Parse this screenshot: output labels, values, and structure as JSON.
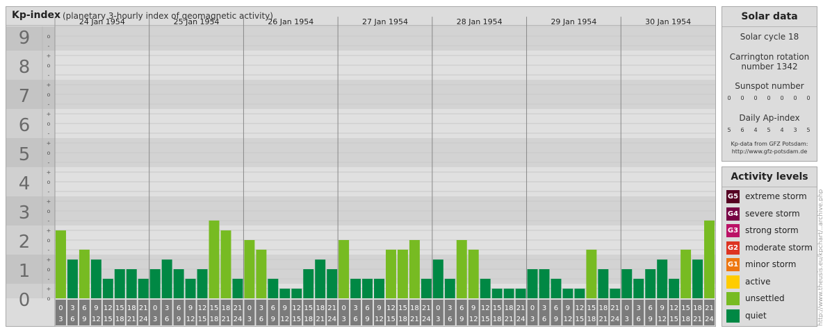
{
  "header": {
    "title": "Kp-index",
    "subtitle": "(planetary 3-hourly index of geomagnetic activity)"
  },
  "chart_data": {
    "type": "bar",
    "title": "Kp-index",
    "subtitle": "(planetary 3-hourly index of geomagnetic activity)",
    "days": [
      "24 Jan 1954",
      "25 Jan 1954",
      "26 Jan 1954",
      "27 Jan 1954",
      "28 Jan 1954",
      "29 Jan 1954",
      "30 Jan 1954"
    ],
    "interval_labels": [
      [
        "0",
        "3"
      ],
      [
        "3",
        "6"
      ],
      [
        "6",
        "9"
      ],
      [
        "9",
        "12"
      ],
      [
        "12",
        "15"
      ],
      [
        "15",
        "18"
      ],
      [
        "18",
        "21"
      ],
      [
        "21",
        "24"
      ]
    ],
    "y_axis_labels": [
      "0",
      "1",
      "2",
      "3",
      "4",
      "5",
      "6",
      "7",
      "8",
      "9"
    ],
    "sub_tick_labels": [
      "+",
      "o",
      "-"
    ],
    "ylim": [
      0,
      9.33
    ],
    "values": [
      [
        2.33,
        1.33,
        1.67,
        1.33,
        0.67,
        1.0,
        1.0,
        0.67
      ],
      [
        1.0,
        1.33,
        1.0,
        0.67,
        1.0,
        2.67,
        2.33,
        0.67
      ],
      [
        2.0,
        1.67,
        0.67,
        0.33,
        0.33,
        1.0,
        1.33,
        1.0
      ],
      [
        2.0,
        0.67,
        0.67,
        0.67,
        1.67,
        1.67,
        2.0,
        0.67
      ],
      [
        1.33,
        0.67,
        2.0,
        1.67,
        0.67,
        0.33,
        0.33,
        0.33
      ],
      [
        1.0,
        1.0,
        0.67,
        0.33,
        0.33,
        1.67,
        1.0,
        0.33
      ],
      [
        1.0,
        0.67,
        1.0,
        1.33,
        0.67,
        1.67,
        1.33,
        2.67
      ]
    ],
    "series_colors": {
      "quiet": "#008844",
      "unsettled": "#77bb22"
    },
    "grid": true
  },
  "solar": {
    "title": "Solar data",
    "cycle": "Solar cycle 18",
    "carrington_line1": "Carrington rotation",
    "carrington_line2": "number 1342",
    "sunspot_label": "Sunspot number",
    "sunspot_values": [
      "0",
      "0",
      "0",
      "0",
      "0",
      "0",
      "0"
    ],
    "ap_label": "Daily Ap-index",
    "ap_values": [
      "5",
      "6",
      "4",
      "5",
      "4",
      "3",
      "5"
    ],
    "credit_line1": "Kp-data from GFZ Potsdam:",
    "credit_line2": "http://www.gfz-potsdam.de"
  },
  "activity": {
    "title": "Activity levels",
    "levels": [
      {
        "code": "G5",
        "label": "extreme storm",
        "color": "#550022"
      },
      {
        "code": "G4",
        "label": "severe storm",
        "color": "#770044"
      },
      {
        "code": "G3",
        "label": "strong storm",
        "color": "#bb1166"
      },
      {
        "code": "G2",
        "label": "moderate storm",
        "color": "#dd3322"
      },
      {
        "code": "G1",
        "label": "minor storm",
        "color": "#ee7711"
      },
      {
        "code": "",
        "label": "active",
        "color": "#ffcc00"
      },
      {
        "code": "",
        "label": "unsettled",
        "color": "#77bb22"
      },
      {
        "code": "",
        "label": "quiet",
        "color": "#008844"
      }
    ]
  },
  "watermark": "http://www.theusis.eu/kpchart/..archive.php"
}
